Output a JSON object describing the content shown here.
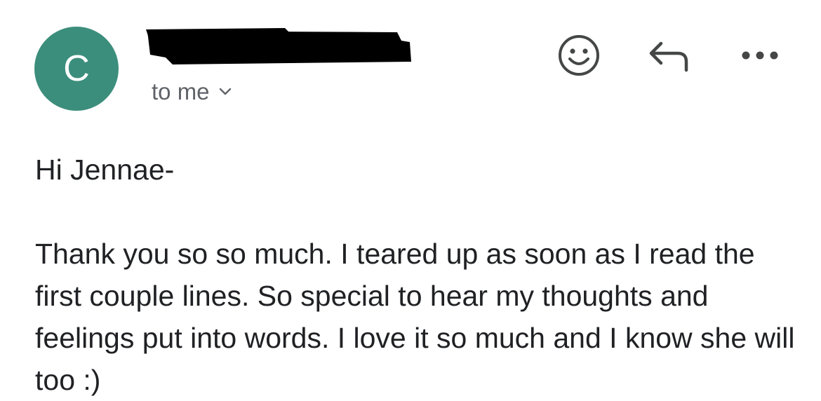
{
  "sender": {
    "avatar_letter": "C",
    "avatar_color": "#3c8e7c",
    "name_redacted": true
  },
  "recipient": {
    "label": "to me"
  },
  "actions": {
    "emoji_icon": "smiley-face-icon",
    "reply_icon": "reply-arrow-icon",
    "more_icon": "more-dots-icon"
  },
  "email": {
    "greeting": "Hi Jennae-",
    "message": "Thank you so so much. I teared up as soon as I read the first couple lines. So special to hear my thoughts and feelings put into words. I love it so much and I know she will too :)"
  }
}
